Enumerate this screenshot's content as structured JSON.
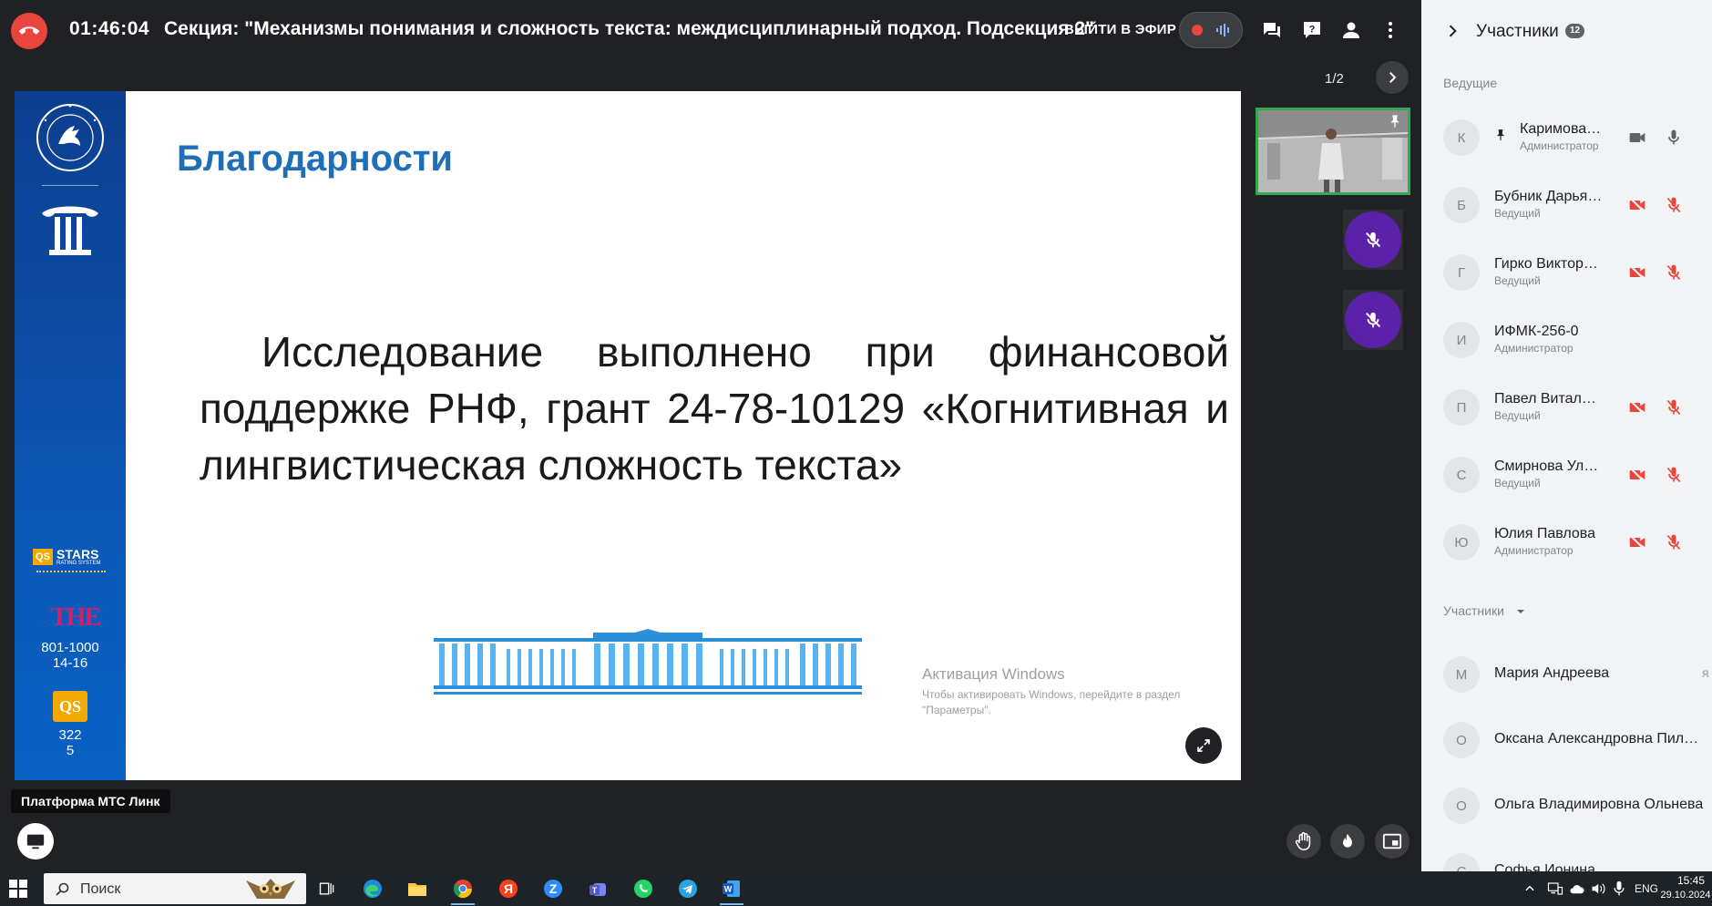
{
  "meeting": {
    "timer": "01:46:04",
    "title": "Секция: \"Механизмы понимания и сложность текста: междисциплинарный подход. Подсекция 2\"",
    "go_live_label": "ВЫЙТИ В ЭФИР"
  },
  "slide": {
    "page_counter": "1/2",
    "heading": "Благодарности",
    "body": "Исследование выполнено при финансовой поддержке РНФ, грант 24-78-10129 «Когнитивная и лингвистическая сложность текста»",
    "badges": {
      "stars_title": "STARS",
      "stars_sub": "RATING SYSTEM",
      "stars_qs": "QS",
      "the_logo": "THE",
      "the_rank_1": "801-1000",
      "the_rank_2": "14-16",
      "qs_logo": "QS",
      "qs_rank_1": "322",
      "qs_rank_2": "5"
    },
    "windows_activation": {
      "title": "Активация Windows",
      "subtitle": "Чтобы активировать Windows, перейдите в раздел \"Параметры\"."
    }
  },
  "bottom": {
    "tooltip": "Платформа МТС Линк"
  },
  "panel": {
    "title": "Участники",
    "count": "12",
    "hosts_label": "Ведущие",
    "participants_label": "Участники",
    "hosts": [
      {
        "initial": "К",
        "name": "Каримова…",
        "role": "Администратор",
        "pinned": true
      },
      {
        "initial": "Б",
        "name": "Бубник Дарья…",
        "role": "Ведущий"
      },
      {
        "initial": "Г",
        "name": "Гирко Виктор…",
        "role": "Ведущий"
      },
      {
        "initial": "И",
        "name": "ИФМК-256-0",
        "role": "Администратор"
      },
      {
        "initial": "П",
        "name": "Павел Витал…",
        "role": "Ведущий"
      },
      {
        "initial": "С",
        "name": "Смирнова Ул…",
        "role": "Ведущий"
      },
      {
        "initial": "Ю",
        "name": "Юлия Павлова",
        "role": "Администратор"
      }
    ],
    "participants": [
      {
        "initial": "М",
        "name": "Мария Андреева",
        "trail": "я"
      },
      {
        "initial": "О",
        "name": "Оксана Александровна Пиль…"
      },
      {
        "initial": "О",
        "name": "Ольга Владимировна Ольнева"
      },
      {
        "initial": "С",
        "name": "Софья Ионина…"
      }
    ]
  },
  "taskbar": {
    "search_placeholder": "Поиск",
    "lang": "ENG",
    "time": "15:45",
    "date": "29.10.2024"
  },
  "colors": {
    "end_call": "#e8453c",
    "muted_red": "#e8453c",
    "purple_tile": "#5b21a8",
    "active_speaker": "#34a853",
    "slide_heading": "#1f6fb8",
    "slide_side": "#0b55b3"
  }
}
